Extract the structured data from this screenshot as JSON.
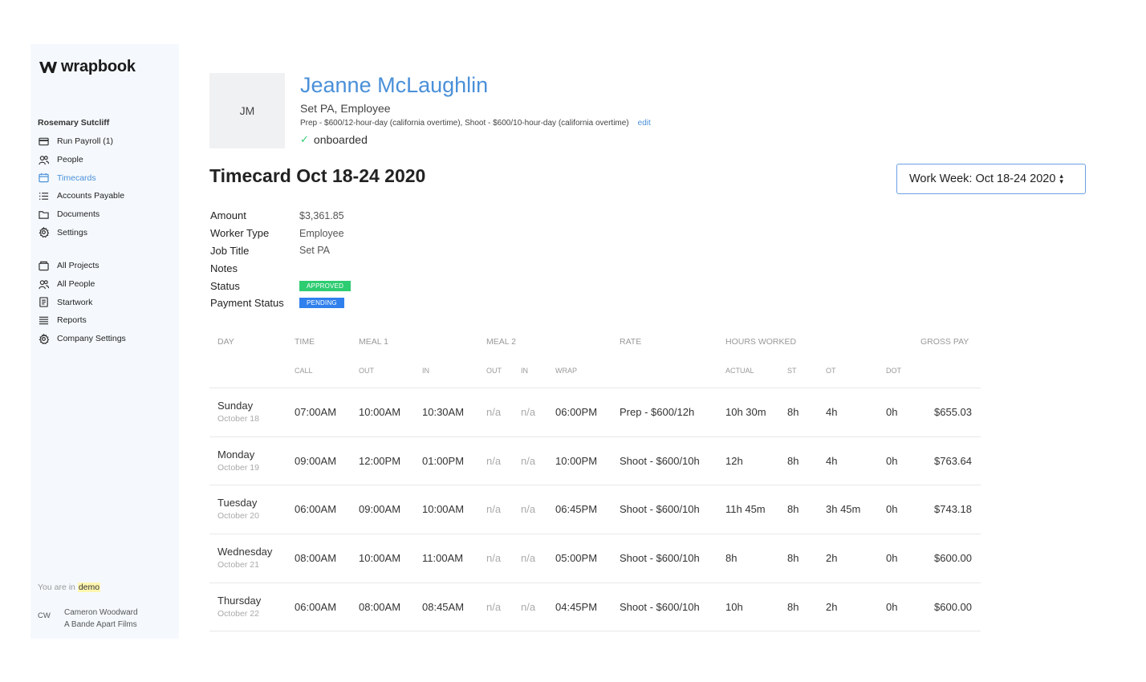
{
  "brand": {
    "name": "wrapbook"
  },
  "sidebar": {
    "org_name": "Rosemary Sutcliff",
    "project_nav": [
      {
        "label": "Run Payroll",
        "count": "(1)",
        "icon": "credit-card-icon",
        "active": false
      },
      {
        "label": "People",
        "icon": "people-icon",
        "active": false
      },
      {
        "label": "Timecards",
        "icon": "calendar-icon",
        "active": true
      },
      {
        "label": "Accounts Payable",
        "icon": "list-icon",
        "active": false
      },
      {
        "label": "Documents",
        "icon": "folder-icon",
        "active": false
      },
      {
        "label": "Settings",
        "icon": "gear-icon",
        "active": false
      }
    ],
    "company_nav": [
      {
        "label": "All Projects",
        "icon": "briefcase-icon"
      },
      {
        "label": "All People",
        "icon": "people-icon"
      },
      {
        "label": "Startwork",
        "icon": "document-icon"
      },
      {
        "label": "Reports",
        "icon": "lines-icon"
      },
      {
        "label": "Company Settings",
        "icon": "gear-icon"
      }
    ],
    "env_prefix": "You are in",
    "env_name": "demo",
    "user": {
      "initials": "CW",
      "name": "Cameron Woodward",
      "company": "A Bande Apart Films"
    }
  },
  "person": {
    "initials": "JM",
    "name": "Jeanne McLaughlin",
    "role": "Set PA, Employee",
    "rates": "Prep - $600/12-hour-day (california overtime), Shoot - $600/10-hour-day (california overtime)",
    "edit_label": "edit",
    "status": "onboarded"
  },
  "timecard": {
    "title": "Timecard Oct 18-24 2020",
    "week_select": "Work Week: Oct 18-24 2020",
    "details": [
      {
        "label": "Amount",
        "value": "$3,361.85"
      },
      {
        "label": "Worker Type",
        "value": "Employee"
      },
      {
        "label": "Job Title",
        "value": "Set PA"
      },
      {
        "label": "Notes",
        "value": ""
      }
    ],
    "status_label": "Status",
    "status_value": "APPROVED",
    "payment_status_label": "Payment Status",
    "payment_status_value": "PENDING"
  },
  "table": {
    "group_headers": [
      "DAY",
      "TIME",
      "MEAL 1",
      "MEAL 2",
      "RATE",
      "HOURS WORKED",
      "GROSS PAY"
    ],
    "sub_headers": [
      "CALL",
      "OUT",
      "IN",
      "OUT",
      "IN",
      "WRAP",
      "ACTUAL",
      "ST",
      "OT",
      "DOT"
    ],
    "rows": [
      {
        "day": "Sunday",
        "date": "October 18",
        "call": "07:00AM",
        "m1out": "10:00AM",
        "m1in": "10:30AM",
        "m2out": "n/a",
        "m2in": "n/a",
        "wrap": "06:00PM",
        "rate": "Prep - $600/12h",
        "actual": "10h 30m",
        "st": "8h",
        "ot": "4h",
        "dot": "0h",
        "gross": "$655.03"
      },
      {
        "day": "Monday",
        "date": "October 19",
        "call": "09:00AM",
        "m1out": "12:00PM",
        "m1in": "01:00PM",
        "m2out": "n/a",
        "m2in": "n/a",
        "wrap": "10:00PM",
        "rate": "Shoot - $600/10h",
        "actual": "12h",
        "st": "8h",
        "ot": "4h",
        "dot": "0h",
        "gross": "$763.64"
      },
      {
        "day": "Tuesday",
        "date": "October 20",
        "call": "06:00AM",
        "m1out": "09:00AM",
        "m1in": "10:00AM",
        "m2out": "n/a",
        "m2in": "n/a",
        "wrap": "06:45PM",
        "rate": "Shoot - $600/10h",
        "actual": "11h 45m",
        "st": "8h",
        "ot": "3h 45m",
        "dot": "0h",
        "gross": "$743.18"
      },
      {
        "day": "Wednesday",
        "date": "October 21",
        "call": "08:00AM",
        "m1out": "10:00AM",
        "m1in": "11:00AM",
        "m2out": "n/a",
        "m2in": "n/a",
        "wrap": "05:00PM",
        "rate": "Shoot - $600/10h",
        "actual": "8h",
        "st": "8h",
        "ot": "2h",
        "dot": "0h",
        "gross": "$600.00"
      },
      {
        "day": "Thursday",
        "date": "October 22",
        "call": "06:00AM",
        "m1out": "08:00AM",
        "m1in": "08:45AM",
        "m2out": "n/a",
        "m2in": "n/a",
        "wrap": "04:45PM",
        "rate": "Shoot - $600/10h",
        "actual": "10h",
        "st": "8h",
        "ot": "2h",
        "dot": "0h",
        "gross": "$600.00"
      }
    ]
  }
}
